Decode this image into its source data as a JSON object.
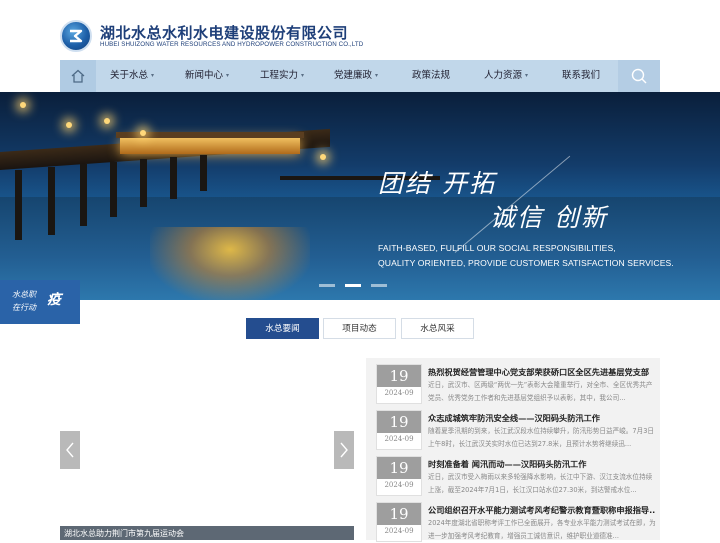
{
  "header": {
    "company_cn": "湖北水总水利水电建设股份有限公司",
    "company_en": "HUBEI SHUIZONG WATER RESOURCES AND HYDROPOWER CONSTRUCTION CO.,LTD"
  },
  "nav": {
    "items": [
      {
        "label": "关于水总",
        "dropdown": true
      },
      {
        "label": "新闻中心",
        "dropdown": true
      },
      {
        "label": "工程实力",
        "dropdown": true
      },
      {
        "label": "党建廉政",
        "dropdown": true
      },
      {
        "label": "政策法规",
        "dropdown": false
      },
      {
        "label": "人力资源",
        "dropdown": true
      },
      {
        "label": "联系我们",
        "dropdown": false
      }
    ]
  },
  "banner": {
    "slogan_line1": "团结 开拓",
    "slogan_line2": "诚信 创新",
    "en_line1": "FAITH-BASED, FULFILL OUR SOCIAL RESPONSIBILITIES,",
    "en_line2": "QUALITY ORIENTED, PROVIDE CUSTOMER SATISFACTION SERVICES.",
    "active_slide": 2,
    "slide_count": 3
  },
  "badge": {
    "line1": "水总职",
    "line2": "在行动",
    "big": "疫"
  },
  "tabs": [
    {
      "label": "水总要闻",
      "active": true
    },
    {
      "label": "项目动态",
      "active": false
    },
    {
      "label": "水总风采",
      "active": false
    }
  ],
  "carousel": {
    "caption": "湖北水总助力荆门市第九届运动会"
  },
  "news": [
    {
      "day": "19",
      "ym": "2024-09",
      "title": "热烈祝贺经营管理中心党支部荣获硚口区全区先进基层党支部",
      "body": "近日，武汉市、区两级“两优一先”表彰大会隆重举行，对全市、全区优秀共产党员、优秀党务工作者和先进基层党组织予以表彰，其中，我公司..."
    },
    {
      "day": "19",
      "ym": "2024-09",
      "title": "众志成城筑牢防汛安全线——汉阳码头防汛工作",
      "body": "随着夏季汛期的到来，长江武汉段水位持续攀升，防汛形势日益严峻。7月3日上午8时，长江武汉关实时水位已达到27.8米，且预计水势将继续迅..."
    },
    {
      "day": "19",
      "ym": "2024-09",
      "title": "时刻准备着 闻汛而动——汉阳码头防汛工作",
      "body": "近日，武汉市受入梅雨以来多轮强降水影响，长江中下游、汉江支流水位持续上涨，截至2024年7月1日，长江汉口站水位27.30米，到达警戒水位..."
    },
    {
      "day": "19",
      "ym": "2024-09",
      "title": "公司组织召开水平能力测试考风考纪警示教育暨职称申报指导...",
      "body": "2024年度湖北省职称考评工作已全面展开，各专业水平能力测试考试在即，为进一步加强考风考纪教育，增强员工诚信意识，维护职业道德准..."
    }
  ],
  "colors": {
    "brand_blue": "#244d8f",
    "nav_bg": "#c1d7ea",
    "badge_blue": "#2a63a8"
  }
}
